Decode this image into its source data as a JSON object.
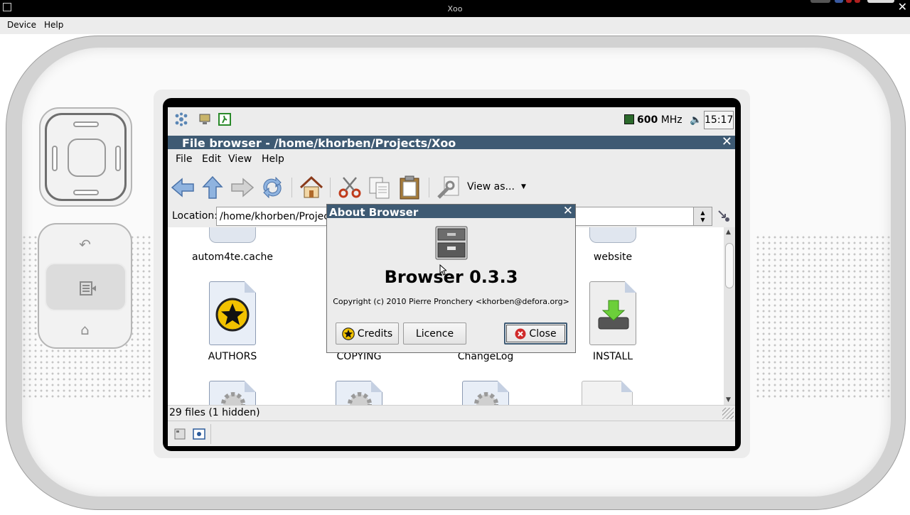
{
  "host": {
    "title": "Xoo",
    "menu": {
      "device": "Device",
      "help": "Help"
    }
  },
  "panel": {
    "cpu_value": "600",
    "cpu_unit": "MHz",
    "clock": "15:17"
  },
  "file_browser": {
    "title": "File browser - /home/khorben/Projects/Xoo",
    "menu": {
      "file": "File",
      "edit": "Edit",
      "view": "View",
      "help": "Help"
    },
    "toolbar": {
      "view_as": "View as..."
    },
    "location_label": "Location:",
    "location_value": "/home/khorben/Projects/Xoo",
    "items": [
      {
        "name": "autom4te.cache"
      },
      {
        "name": "website"
      },
      {
        "name": "AUTHORS"
      },
      {
        "name": "COPYING"
      },
      {
        "name": "ChangeLog"
      },
      {
        "name": "INSTALL"
      }
    ],
    "status": "29 files (1 hidden)"
  },
  "about": {
    "title": "About Browser",
    "app_name": "Browser 0.3.3",
    "copyright": "Copyright (c) 2010 Pierre Pronchery <khorben@defora.org>",
    "buttons": {
      "credits": "Credits",
      "licence": "Licence",
      "close": "Close"
    }
  },
  "colors": {
    "titlebar": "#3e5a73",
    "panel": "#ececec",
    "close_red": "#d02a2a"
  }
}
